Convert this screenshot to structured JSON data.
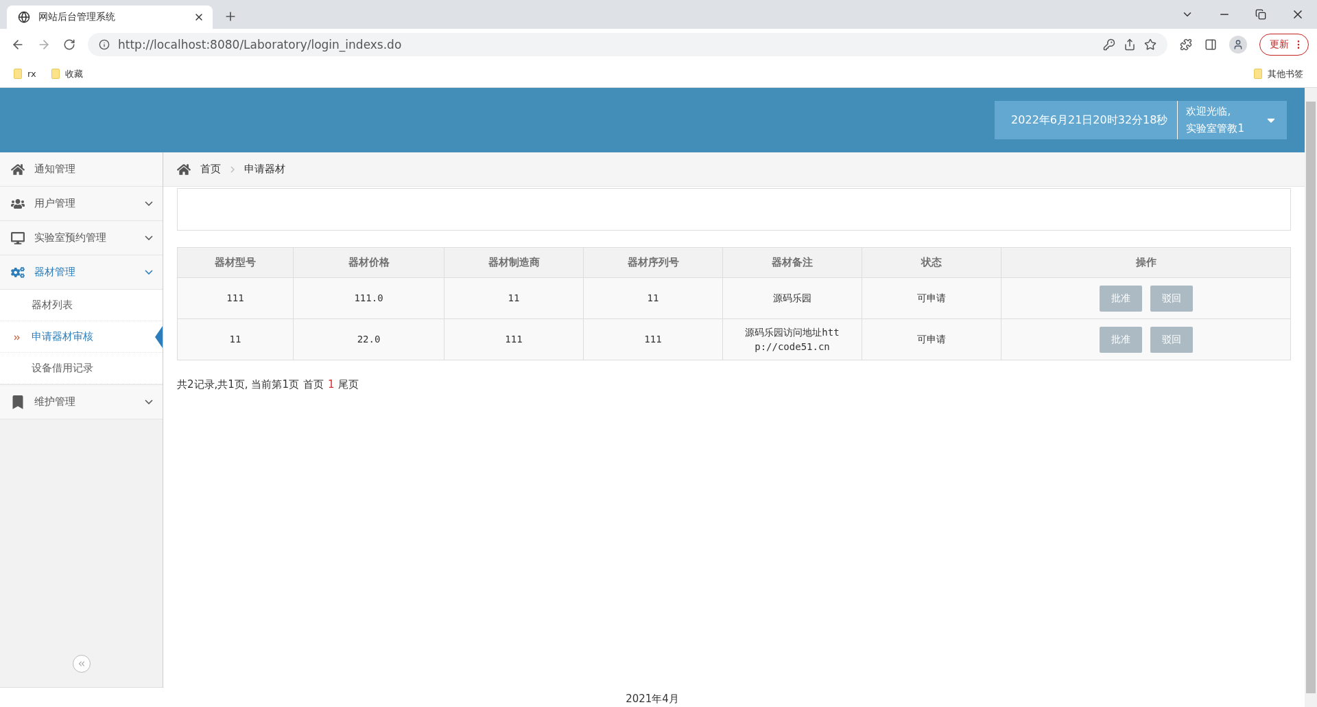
{
  "browser": {
    "tab_title": "网站后台管理系统",
    "url": "http://localhost:8080/Laboratory/login_indexs.do",
    "bookmarks": [
      "rx",
      "收藏"
    ],
    "other_bookmarks": "其他书签",
    "update_button": "更新"
  },
  "header": {
    "datetime": "2022年6月21日20时32分18秒",
    "welcome": "欢迎光临,",
    "user": "实验室管教1"
  },
  "sidebar": {
    "items": [
      {
        "label": "通知管理",
        "selected": false,
        "expandable": false
      },
      {
        "label": "用户管理",
        "selected": false,
        "expandable": true
      },
      {
        "label": "实验室预约管理",
        "selected": false,
        "expandable": true
      },
      {
        "label": "器材管理",
        "selected": true,
        "expandable": true,
        "children": [
          {
            "label": "器材列表",
            "selected": false
          },
          {
            "label": "申请器材审核",
            "selected": true
          },
          {
            "label": "设备借用记录",
            "selected": false
          }
        ]
      },
      {
        "label": "维护管理",
        "selected": false,
        "expandable": true
      }
    ]
  },
  "breadcrumb": [
    "首页",
    "申请器材"
  ],
  "table": {
    "columns": [
      "器材型号",
      "器材价格",
      "器材制造商",
      "器材序列号",
      "器材备注",
      "状态",
      "操作"
    ],
    "rows": [
      {
        "cells": [
          "111",
          "111.0",
          "11",
          "11",
          "源码乐园",
          "可申请"
        ],
        "actions": [
          "批准",
          "驳回"
        ]
      },
      {
        "cells": [
          "11",
          "22.0",
          "111",
          "111",
          "源码乐园访问地址http://code51.cn",
          "可申请"
        ],
        "actions": [
          "批准",
          "驳回"
        ]
      }
    ]
  },
  "pagination": {
    "summary": "共2记录,共1页, 当前第1页",
    "first": "首页",
    "pages": [
      {
        "label": "1",
        "selected": true
      }
    ],
    "last": "尾页"
  },
  "footer": "2021年4月"
}
